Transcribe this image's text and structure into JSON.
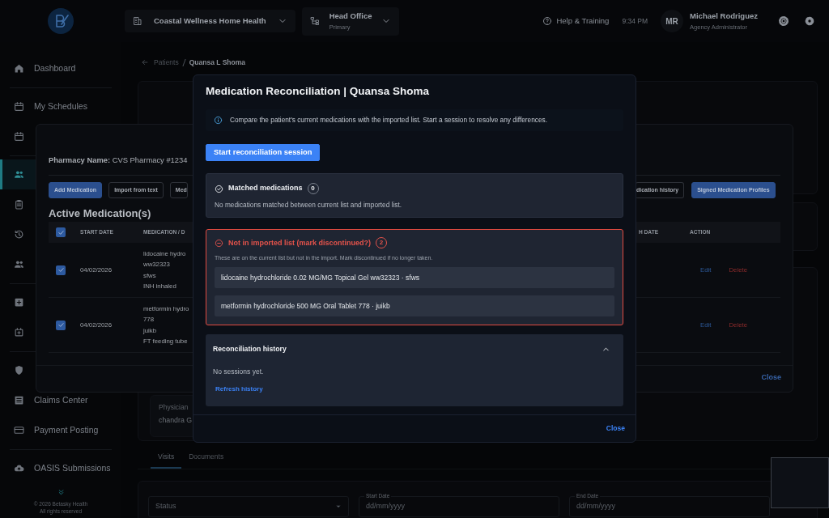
{
  "top_bar": {
    "organization": "Coastal Wellness Home Health",
    "office": {
      "name": "Head Office",
      "subtitle": "Primary"
    },
    "help": "Help & Training",
    "time": "9:34 PM",
    "user": {
      "initials": "MR",
      "name": "Michael Rodriguez",
      "role": "Agency Administrator"
    }
  },
  "sidebar": {
    "items": [
      {
        "label": "Dashboard",
        "selected": false,
        "group_start": false
      },
      {
        "label": "My Schedules",
        "selected": false,
        "group_start": true
      },
      {
        "selected": false,
        "group_start": false
      },
      {
        "selected": true,
        "group_start": true
      },
      {
        "selected": false,
        "group_start": false
      },
      {
        "selected": false,
        "group_start": false
      },
      {
        "selected": false,
        "group_start": false
      },
      {
        "selected": false,
        "group_start": true
      },
      {
        "selected": false,
        "group_start": false
      },
      {
        "selected": false,
        "group_start": true
      },
      {
        "label": "Claims Center",
        "selected": false,
        "group_start": false
      },
      {
        "label": "Payment Posting",
        "selected": false,
        "group_start": false
      },
      {
        "label": "OASIS Submissions",
        "selected": false,
        "group_start": true
      }
    ],
    "footer": [
      "© 2026 Betasky Health",
      "All rights reserved"
    ]
  },
  "breadcrumb": {
    "parent": "Patients",
    "current": "Quansa L Shoma"
  },
  "physician": {
    "label": "Physician",
    "value": "chandra G"
  },
  "tabs": [
    {
      "label": "Visits",
      "selected": true
    },
    {
      "label": "Documents",
      "selected": false
    }
  ],
  "filters": [
    {
      "kind": "select",
      "placeholder": "Status"
    },
    {
      "kind": "date",
      "label": "Start Date",
      "placeholder": "dd/mm/yyyy"
    },
    {
      "kind": "date",
      "label": "End Date",
      "placeholder": "dd/mm/yyyy"
    }
  ],
  "medication_dialog": {
    "pharmacy": "**Pharmacy Name:** CVS Pharmacy #1234",
    "buttons_left": [
      {
        "label": "Add Medication",
        "primary": true
      },
      {
        "label": "Import from text",
        "primary": false
      },
      {
        "label": "Med",
        "primary": false
      }
    ],
    "buttons_right": [
      {
        "label": "dication history",
        "primary": false
      },
      {
        "label": "Signed Medication Profiles",
        "primary": true
      }
    ],
    "heading": "Active Medication(s)",
    "all_checked": true,
    "columns_left": [
      "START DATE",
      "MEDICATION / D"
    ],
    "columns_right": [
      "H DATE",
      "ACTION"
    ],
    "rows": [
      {
        "checked": true,
        "start_date": "04/02/2026",
        "medication": [
          "lidocaine hydro",
          "ww32323",
          "sfws",
          "INH inhaled"
        ],
        "actions": [
          "Edit",
          "Delete"
        ]
      },
      {
        "checked": true,
        "start_date": "04/02/2026",
        "medication": [
          "metformin hydro",
          "778",
          "juikb",
          "FT feeding tube"
        ],
        "actions": [
          "Edit",
          "Delete"
        ]
      }
    ],
    "close": "Close"
  },
  "reconciliation_dialog": {
    "title": "Medication Reconciliation | Quansa Shoma",
    "info": "Compare the patient's current medications with the imported list. Start a session to resolve any differences.",
    "start_button": "Start reconciliation session",
    "sections": [
      {
        "kind": "matched",
        "title": "Matched medications",
        "count": "0",
        "text": "No medications matched between current list and imported list."
      },
      {
        "kind": "missing",
        "title": "Not in imported list (mark discontinued?)",
        "count": "2",
        "text": "These are on the current list but not in the import. Mark discontinued if no longer taken.",
        "items": [
          "lidocaine hydrochloride 0.02 MG/MG Topical Gel ww32323 · sfws",
          "metformin hydrochloride 500 MG Oral Tablet 778 · juikb"
        ]
      }
    ],
    "history": {
      "title": "Reconciliation history",
      "expanded": true,
      "empty": "No sessions yet.",
      "refresh": "Refresh history"
    },
    "close": "Close"
  }
}
